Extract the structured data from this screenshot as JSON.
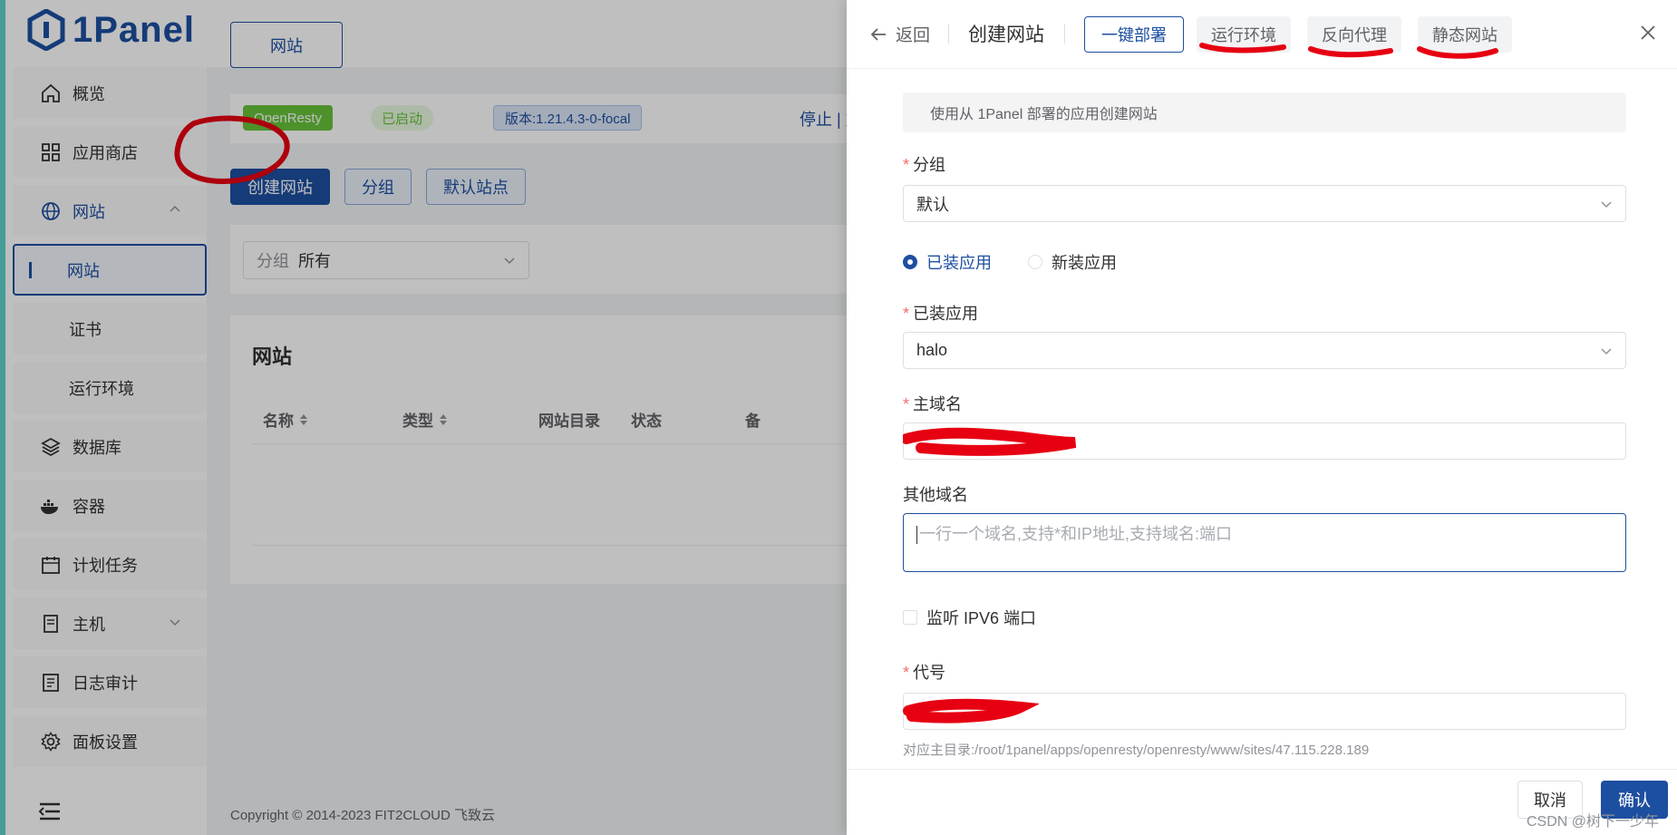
{
  "brand": {
    "name": "1Panel"
  },
  "sidebar": {
    "items": [
      {
        "label": "概览",
        "icon": "home-icon"
      },
      {
        "label": "应用商店",
        "icon": "grid-icon"
      },
      {
        "label": "网站",
        "icon": "globe-icon"
      },
      {
        "label": "网站",
        "icon": ""
      },
      {
        "label": "证书",
        "icon": ""
      },
      {
        "label": "运行环境",
        "icon": ""
      },
      {
        "label": "数据库",
        "icon": "layers-icon"
      },
      {
        "label": "容器",
        "icon": "docker-icon"
      },
      {
        "label": "计划任务",
        "icon": "calendar-icon"
      },
      {
        "label": "主机",
        "icon": "host-icon"
      },
      {
        "label": "日志审计",
        "icon": "log-icon"
      },
      {
        "label": "面板设置",
        "icon": "gear-icon"
      }
    ]
  },
  "main": {
    "tab_label": "网站",
    "app_bar": {
      "app_name": "OpenResty",
      "status": "已启动",
      "version": "版本:1.21.4.3-0-focal",
      "actions": "停止 | 重"
    },
    "toolbar": {
      "create": "创建网站",
      "group": "分组",
      "default_site": "默认站点"
    },
    "filter": {
      "prefix": "分组",
      "value": "所有"
    },
    "list": {
      "title": "网站",
      "columns": [
        "名称",
        "类型",
        "网站目录",
        "状态",
        "备"
      ]
    },
    "footer": "Copyright © 2014-2023 FIT2CLOUD 飞致云"
  },
  "drawer": {
    "back_label": "返回",
    "title": "创建网站",
    "segments": [
      "一键部署",
      "运行环境",
      "反向代理",
      "静态网站"
    ],
    "alert": "使用从 1Panel 部署的应用创建网站",
    "group_label": "分组",
    "group_value": "默认",
    "radio_installed": "已装应用",
    "radio_new": "新装应用",
    "installed_app_label": "已装应用",
    "installed_app_value": "halo",
    "primary_domain_label": "主域名",
    "other_domains_label": "其他域名",
    "other_domains_placeholder": "一行一个域名,支持*和IP地址,支持域名:端口",
    "ipv6_label": "监听 IPV6 端口",
    "alias_label": "代号",
    "alias_hint": "对应主目录:/root/1panel/apps/openresty/openresty/www/sites/47.115.228.189",
    "cancel": "取消",
    "confirm": "确认"
  },
  "watermark": "CSDN @树下一少年",
  "colors": {
    "primary": "#1d4fa0",
    "success": "#67c23a",
    "danger": "#f56c6c",
    "annotation": "#e60012"
  }
}
